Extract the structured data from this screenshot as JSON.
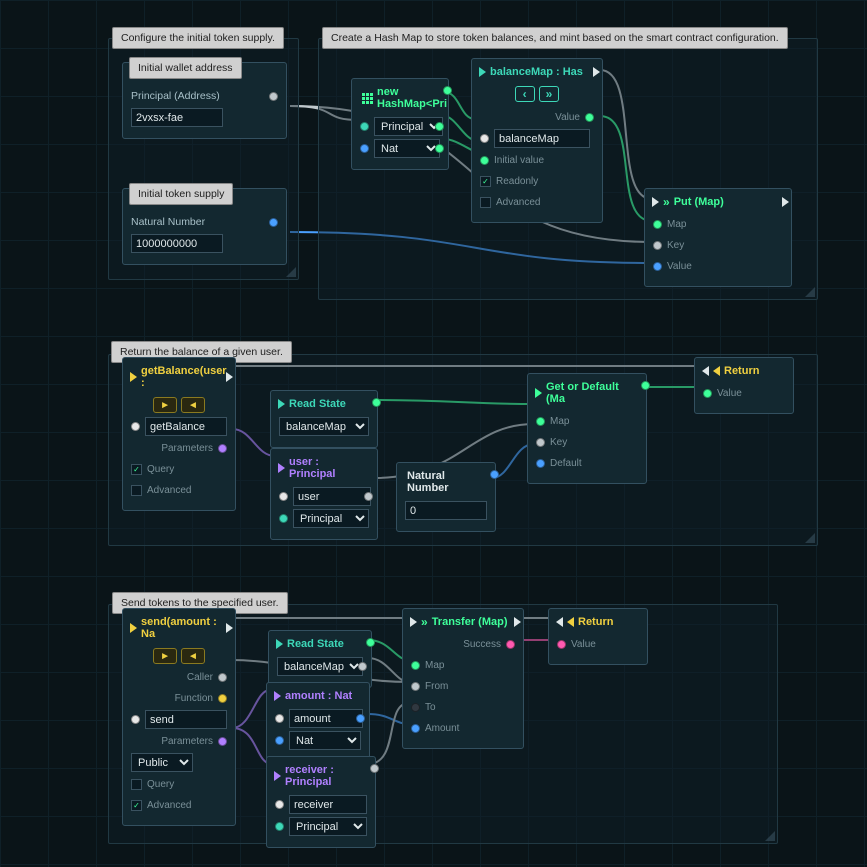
{
  "sections": {
    "config": {
      "caption": "Configure the initial token supply.",
      "wallet_label": "Initial wallet address",
      "principal_label": "Principal (Address)",
      "principal_value": "2vxsx-fae",
      "supply_label": "Initial token supply",
      "nat_label": "Natural Number",
      "nat_value": "1000000000"
    },
    "hashmap": {
      "caption": "Create a Hash Map to store token balances, and mint based on the smart contract configuration.",
      "new_node_title": "new HashMap<Pri",
      "type1": "Principal",
      "type2": "Nat",
      "balmap_title": "balanceMap : Has",
      "nav_prev": "‹",
      "nav_next": "»",
      "value_label": "Value",
      "name_field": "balanceMap",
      "initval_label": "Initial value",
      "readonly_label": "Readonly",
      "advanced_label": "Advanced",
      "put_title": "Put (Map)",
      "put_map": "Map",
      "put_key": "Key",
      "put_value": "Value"
    },
    "getbal": {
      "caption": "Return the balance of a given user.",
      "fn_title": "getBalance(user :",
      "play": "►",
      "back": "◄",
      "fn_name": "getBalance",
      "params_label": "Parameters",
      "query_label": "Query",
      "advanced_label": "Advanced",
      "read_title": "Read State",
      "read_select": "balanceMap : Ha",
      "user_title": "user : Principal",
      "user_name": "user",
      "user_type": "Principal",
      "nat_title": "Natural Number",
      "nat_value": "0",
      "getdef_title": "Get or Default (Ma",
      "getdef_map": "Map",
      "getdef_key": "Key",
      "getdef_default": "Default",
      "return_title": "Return",
      "return_value": "Value"
    },
    "send": {
      "caption": "Send tokens to the specified user.",
      "fn_title": "send(amount : Na",
      "play": "►",
      "back": "◄",
      "caller_label": "Caller",
      "function_label": "Function",
      "fn_name": "send",
      "params_label": "Parameters",
      "visibility": "Public",
      "query_label": "Query",
      "advanced_label": "Advanced",
      "read_title": "Read State",
      "read_select": "balanceMap : Ha",
      "amount_title": "amount : Nat",
      "amount_name": "amount",
      "amount_type": "Nat",
      "receiver_title": "receiver : Principal",
      "receiver_name": "receiver",
      "receiver_type": "Principal",
      "transfer_title": "Transfer (Map)",
      "transfer_map": "Map",
      "transfer_from": "From",
      "transfer_to": "To",
      "transfer_amount": "Amount",
      "transfer_success": "Success",
      "return_title": "Return",
      "return_value": "Value"
    }
  }
}
